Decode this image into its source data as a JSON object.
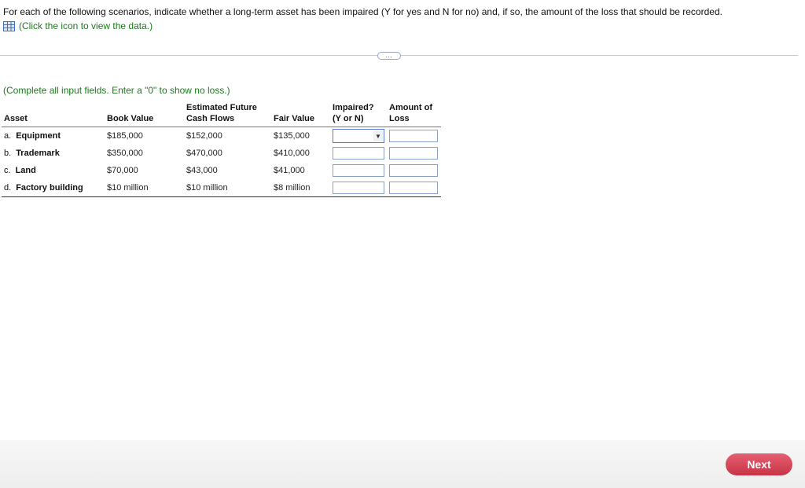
{
  "question": {
    "text": "For each of the following scenarios, indicate whether a long-term asset has been impaired (Y for yes and N for no) and, if so, the amount of the loss that should be recorded.",
    "data_link_label": "(Click the icon to view the data.)",
    "data_icon": "table-grid-icon"
  },
  "more_button": {
    "label": "…"
  },
  "instruction": "(Complete all input fields. Enter a \"0\" to show no loss.)",
  "table": {
    "headers": {
      "asset": "Asset",
      "book_value": "Book Value",
      "cash_flows_line1": "Estimated Future",
      "cash_flows_line2": "Cash Flows",
      "fair_value": "Fair Value",
      "impaired_line1": "Impaired?",
      "impaired_line2": "(Y or N)",
      "loss_line1": "Amount of",
      "loss_line2": "Loss"
    },
    "rows": [
      {
        "letter": "a.",
        "asset": "Equipment",
        "book_value": "$185,000",
        "cash_flows": "$152,000",
        "fair_value": "$135,000"
      },
      {
        "letter": "b.",
        "asset": "Trademark",
        "book_value": "$350,000",
        "cash_flows": "$470,000",
        "fair_value": "$410,000"
      },
      {
        "letter": "c.",
        "asset": "Land",
        "book_value": "$70,000",
        "cash_flows": "$43,000",
        "fair_value": "$41,000"
      },
      {
        "letter": "d.",
        "asset": "Factory building",
        "book_value": "$10 million",
        "cash_flows": "$10 million",
        "fair_value": "$8 million"
      }
    ]
  },
  "footer": {
    "next_label": "Next"
  },
  "colors": {
    "link_green": "#1c7a1c",
    "input_border": "#8aa0c8",
    "next_button": "#d94556"
  }
}
